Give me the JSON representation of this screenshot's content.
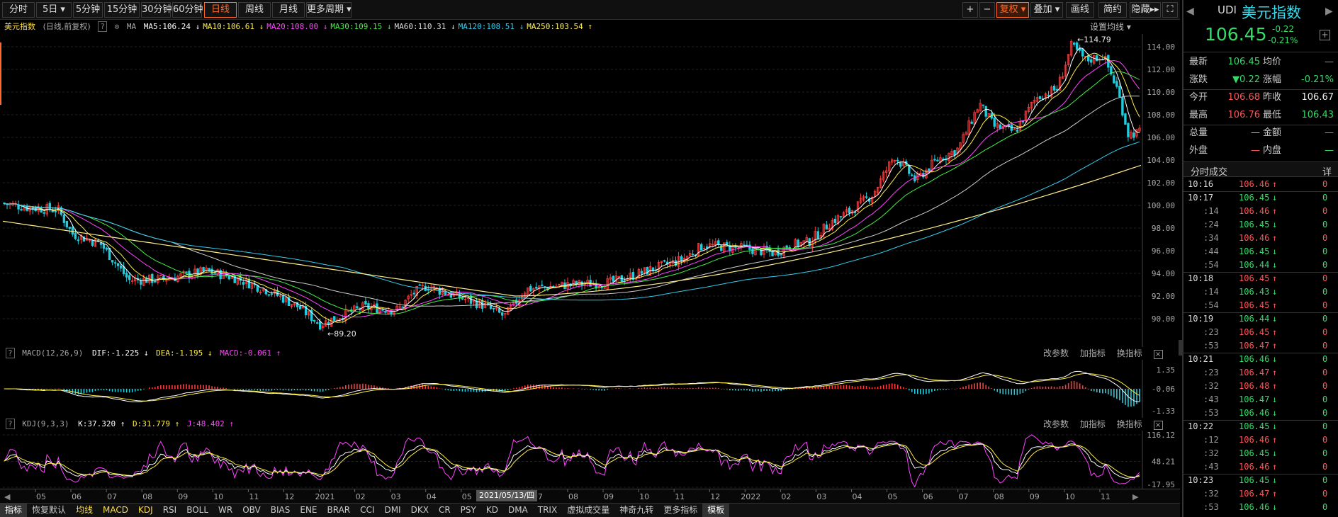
{
  "toolbar": {
    "periods": [
      "分时",
      "5日",
      "5分钟",
      "15分钟",
      "30分钟",
      "60分钟",
      "日线",
      "周线",
      "月线",
      "更多周期"
    ],
    "active_period": "日线",
    "actions": [
      "+",
      "−",
      "复权",
      "叠加",
      "画线",
      "简约",
      "隐藏"
    ]
  },
  "chart_header": {
    "name": "美元指数",
    "meta": "(日线,前复权)",
    "ma_label": "MA",
    "settings": "设置均线",
    "ma": [
      {
        "label": "MA5:106.24",
        "arrow": "↓",
        "color": "#ffffff"
      },
      {
        "label": "MA10:106.61",
        "arrow": "↓",
        "color": "#ffee44"
      },
      {
        "label": "MA20:108.00",
        "arrow": "↓",
        "color": "#ff44ff"
      },
      {
        "label": "MA30:109.15",
        "arrow": "↓",
        "color": "#44ee44"
      },
      {
        "label": "MA60:110.31",
        "arrow": "↓",
        "color": "#dddddd"
      },
      {
        "label": "MA120:108.51",
        "arrow": "↓",
        "color": "#33ccee"
      },
      {
        "label": "MA250:103.54",
        "arrow": "↑",
        "color": "#ffee66"
      }
    ]
  },
  "main_axis": {
    "ticks": [
      "114.00",
      "112.00",
      "110.00",
      "108.00",
      "106.00",
      "104.00",
      "102.00",
      "100.00",
      "98.00",
      "96.00",
      "94.00",
      "92.00",
      "90.00"
    ],
    "high_label": "114.79",
    "low_label": "89.20"
  },
  "macd": {
    "name": "MACD(12,26,9)",
    "dif": "DIF:-1.225",
    "dea": "DEA:-1.195",
    "macd": "MACD:-0.061",
    "ticks": [
      "1.35",
      "-0.06",
      "-1.33"
    ],
    "opts": [
      "改参数",
      "加指标",
      "换指标"
    ]
  },
  "kdj": {
    "name": "KDJ(9,3,3)",
    "k": "K:37.320",
    "d": "D:31.779",
    "j": "J:48.402",
    "ticks": [
      "116.12",
      "48.21",
      "-17.95"
    ],
    "opts": [
      "改参数",
      "加指标",
      "换指标"
    ]
  },
  "x_axis": {
    "labels": [
      "05",
      "06",
      "07",
      "08",
      "09",
      "10",
      "11",
      "12",
      "2021",
      "02",
      "03",
      "04",
      "05",
      "06",
      "07",
      "08",
      "09",
      "10",
      "11",
      "12",
      "2022",
      "02",
      "03",
      "04",
      "05",
      "06",
      "07",
      "08",
      "09",
      "10",
      "11"
    ],
    "tooltip": "2021/05/13/四"
  },
  "bottom_tabs": [
    "指标",
    "恢复默认",
    "均线",
    "MACD",
    "KDJ",
    "RSI",
    "BOLL",
    "WR",
    "OBV",
    "BIAS",
    "ENE",
    "BRAR",
    "CCI",
    "DMI",
    "DKX",
    "CR",
    "PSY",
    "KD",
    "DMA",
    "TRIX",
    "虚拟成交量",
    "神奇九转",
    "更多指标",
    "模板"
  ],
  "quote": {
    "code": "UDI",
    "name": "美元指数",
    "price": "106.45",
    "change": "-0.22",
    "pct": "-0.21%",
    "rows": [
      [
        {
          "l": "最新",
          "v": "106.45",
          "c": "#33dd66"
        },
        {
          "l": "均价",
          "v": "—",
          "c": "#33dd66"
        }
      ],
      [
        {
          "l": "涨跌",
          "v": "▼0.22",
          "c": "#33dd66"
        },
        {
          "l": "涨幅",
          "v": "-0.21%",
          "c": "#33dd66"
        }
      ],
      [
        {
          "l": "今开",
          "v": "106.68",
          "c": "#ff5555"
        },
        {
          "l": "昨收",
          "v": "106.67",
          "c": "#eeeeee"
        }
      ],
      [
        {
          "l": "最高",
          "v": "106.76",
          "c": "#ff5555"
        },
        {
          "l": "最低",
          "v": "106.43",
          "c": "#33dd66"
        }
      ],
      [
        {
          "l": "总量",
          "v": "—",
          "c": "#cccccc"
        },
        {
          "l": "金额",
          "v": "—",
          "c": "#33ccee"
        }
      ],
      [
        {
          "l": "外盘",
          "v": "—",
          "c": "#ff5555"
        },
        {
          "l": "内盘",
          "v": "—",
          "c": "#33dd66"
        }
      ]
    ],
    "trades_title": "分时成交",
    "trades_more": "详",
    "trades": [
      {
        "t": "10:16",
        "p": "106.46",
        "d": "↑",
        "v": "0",
        "major": true
      },
      {
        "t": "10:17",
        "p": "106.45",
        "d": "↓",
        "v": "0",
        "major": true
      },
      {
        "t": ":14",
        "p": "106.46",
        "d": "↑",
        "v": "0"
      },
      {
        "t": ":24",
        "p": "106.45",
        "d": "↓",
        "v": "0"
      },
      {
        "t": ":34",
        "p": "106.46",
        "d": "↑",
        "v": "0"
      },
      {
        "t": ":44",
        "p": "106.45",
        "d": "↓",
        "v": "0"
      },
      {
        "t": ":54",
        "p": "106.44",
        "d": "↓",
        "v": "0"
      },
      {
        "t": "10:18",
        "p": "106.45",
        "d": "↑",
        "v": "0",
        "major": true
      },
      {
        "t": ":14",
        "p": "106.43",
        "d": "↓",
        "v": "0"
      },
      {
        "t": ":54",
        "p": "106.45",
        "d": "↑",
        "v": "0"
      },
      {
        "t": "10:19",
        "p": "106.44",
        "d": "↓",
        "v": "0",
        "major": true
      },
      {
        "t": ":23",
        "p": "106.45",
        "d": "↑",
        "v": "0"
      },
      {
        "t": ":53",
        "p": "106.47",
        "d": "↑",
        "v": "0"
      },
      {
        "t": "10:21",
        "p": "106.46",
        "d": "↓",
        "v": "0",
        "major": true
      },
      {
        "t": ":23",
        "p": "106.47",
        "d": "↑",
        "v": "0"
      },
      {
        "t": ":32",
        "p": "106.48",
        "d": "↑",
        "v": "0"
      },
      {
        "t": ":43",
        "p": "106.47",
        "d": "↓",
        "v": "0"
      },
      {
        "t": ":53",
        "p": "106.46",
        "d": "↓",
        "v": "0"
      },
      {
        "t": "10:22",
        "p": "106.45",
        "d": "↓",
        "v": "0",
        "major": true
      },
      {
        "t": ":12",
        "p": "106.46",
        "d": "↑",
        "v": "0"
      },
      {
        "t": ":32",
        "p": "106.45",
        "d": "↓",
        "v": "0"
      },
      {
        "t": ":43",
        "p": "106.46",
        "d": "↑",
        "v": "0"
      },
      {
        "t": "10:23",
        "p": "106.45",
        "d": "↓",
        "v": "0",
        "major": true
      },
      {
        "t": ":32",
        "p": "106.47",
        "d": "↑",
        "v": "0"
      },
      {
        "t": ":53",
        "p": "106.46",
        "d": "↓",
        "v": "0"
      }
    ]
  }
}
